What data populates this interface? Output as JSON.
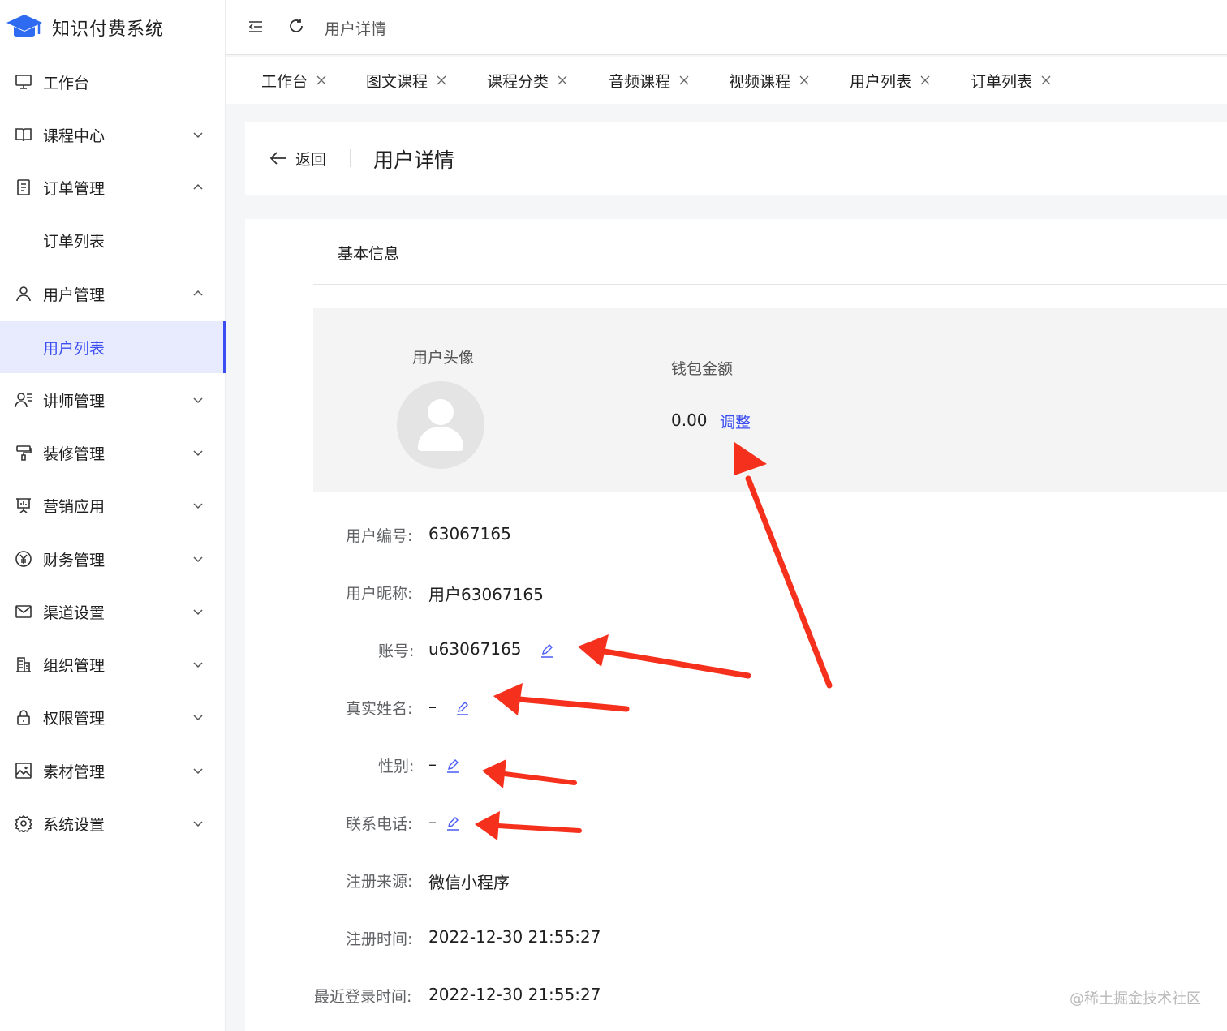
{
  "app": {
    "name": "知识付费系统",
    "logo_icon": "graduation-cap-icon",
    "brand_color": "#3b4ef2"
  },
  "sidebar": {
    "items": [
      {
        "label": "工作台",
        "icon": "monitor-icon",
        "arrow": ""
      },
      {
        "label": "课程中心",
        "icon": "book-icon",
        "arrow": "down"
      },
      {
        "label": "订单管理",
        "icon": "order-icon",
        "arrow": "up"
      },
      {
        "label": "订单列表",
        "icon": "",
        "arrow": ""
      },
      {
        "label": "用户管理",
        "icon": "user-icon",
        "arrow": "up"
      },
      {
        "label": "用户列表",
        "icon": "",
        "arrow": "",
        "active": true
      },
      {
        "label": "讲师管理",
        "icon": "lecturer-icon",
        "arrow": "down"
      },
      {
        "label": "装修管理",
        "icon": "paint-roller-icon",
        "arrow": "down"
      },
      {
        "label": "营销应用",
        "icon": "presentation-icon",
        "arrow": "down"
      },
      {
        "label": "财务管理",
        "icon": "yen-icon",
        "arrow": "down"
      },
      {
        "label": "渠道设置",
        "icon": "mail-icon",
        "arrow": "down"
      },
      {
        "label": "组织管理",
        "icon": "building-icon",
        "arrow": "down"
      },
      {
        "label": "权限管理",
        "icon": "lock-icon",
        "arrow": "down"
      },
      {
        "label": "素材管理",
        "icon": "image-icon",
        "arrow": "down"
      },
      {
        "label": "系统设置",
        "icon": "gear-icon",
        "arrow": "down"
      }
    ]
  },
  "header": {
    "breadcrumb": "用户详情",
    "collapse_icon": "menu-fold-icon",
    "refresh_icon": "refresh-icon"
  },
  "tabs": [
    "工作台",
    "图文课程",
    "课程分类",
    "音频课程",
    "视频课程",
    "用户列表",
    "订单列表"
  ],
  "page": {
    "back_label": "返回",
    "title": "用户详情"
  },
  "basic": {
    "section_title": "基本信息",
    "avatar_label": "用户头像",
    "wallet_label": "钱包金额",
    "wallet_value": "0.00",
    "adjust_label": "调整"
  },
  "fields": [
    {
      "label": "用户编号:",
      "value": "63067165",
      "editable": false
    },
    {
      "label": "用户昵称:",
      "value": "用户63067165",
      "editable": false
    },
    {
      "label": "账号:",
      "value": "u63067165",
      "editable": true
    },
    {
      "label": "真实姓名:",
      "value": "–",
      "editable": true
    },
    {
      "label": "性别:",
      "value": "–",
      "editable": true
    },
    {
      "label": "联系电话:",
      "value": "–",
      "editable": true
    },
    {
      "label": "注册来源:",
      "value": "微信小程序",
      "editable": false
    },
    {
      "label": "注册时间:",
      "value": "2022-12-30 21:55:27",
      "editable": false
    },
    {
      "label": "最近登录时间:",
      "value": "2022-12-30 21:55:27",
      "editable": false
    }
  ],
  "annotation_color": "#f5301c",
  "watermark": "@稀土掘金技术社区"
}
